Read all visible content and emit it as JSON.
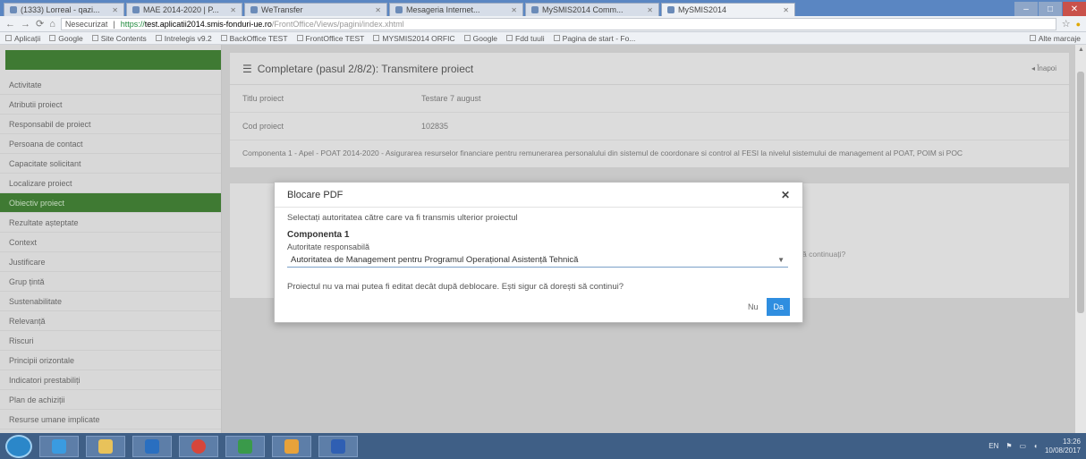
{
  "browser": {
    "tabs": [
      {
        "label": "(1333) Lorreal - qazi..."
      },
      {
        "label": "MAE 2014-2020 | P..."
      },
      {
        "label": "WeTransfer"
      },
      {
        "label": "Mesageria Internet..."
      },
      {
        "label": "MySMIS2014 Comm..."
      },
      {
        "label": "MySMIS2014",
        "active": true
      }
    ],
    "window_controls": {
      "minimize": "–",
      "maximize": "□",
      "close": "✕"
    },
    "address": {
      "security": "Nesecurizat",
      "scheme": "https://",
      "host": "test.aplicatii2014.smis-fonduri-ue.ro",
      "path": "/FrontOffice/Views/pagini/index.xhtml"
    },
    "bookmarks": [
      "Aplicații",
      "Google",
      "Site Contents",
      "Intrelegis v9.2",
      "BackOffice TEST",
      "FrontOffice TEST",
      "MYSMIS2014 ORFIC",
      "Google",
      "Fdd tuuli",
      "Pagina de start - Fo..."
    ],
    "bookmarks_right": "Alte marcaje"
  },
  "sidebar": {
    "items": [
      "Activitate",
      "Atributii proiect",
      "Responsabil de proiect",
      "Persoana de contact",
      "Capacitate solicitant",
      "Localizare proiect",
      "Obiectiv proiect",
      "Rezultate așteptate",
      "Context",
      "Justificare",
      "Grup țintă",
      "Sustenabilitate",
      "Relevanță",
      "Riscuri",
      "Principii orizontale",
      "Indicatori prestabiliți",
      "Plan de achiziții",
      "Resurse umane implicate"
    ],
    "active_index": 6
  },
  "main": {
    "title": "Completare (pasul 2/8/2): Transmitere proiect",
    "back_label": "Înapoi",
    "rows": [
      {
        "label": "Titlu proiect",
        "value": "Testare 7 august"
      },
      {
        "label": "Cod proiect",
        "value": "102835"
      }
    ],
    "description": "Componenta 1 - Apel - POAT 2014-2020 - Asigurarea resurselor financiare pentru remunerarea personalului din sistemul de coordonare si control al FESI la nivelul sistemului de management al POAT, POIM si POC",
    "background_text": "ă continuați?"
  },
  "modal": {
    "title": "Blocare PDF",
    "close": "✕",
    "intro": "Selectați autoritatea către care va fi transmis ulterior proiectul",
    "component": "Componenta 1",
    "field_label": "Autoritate responsabilă",
    "selected": "Autoritatea de Management pentru Programul Operațional Asistență Tehnică",
    "warning": "Proiectul nu va mai putea fi editat decât după deblocare. Ești sigur că dorești să continui?",
    "btn_no": "Nu",
    "btn_yes": "Da"
  },
  "taskbar": {
    "lang": "EN",
    "time": "13:26",
    "date": "10/08/2017"
  },
  "colors": {
    "sidebar_active": "#3f7a33",
    "primary_button": "#2f8ee0",
    "taskbar": "#3f5f86"
  }
}
